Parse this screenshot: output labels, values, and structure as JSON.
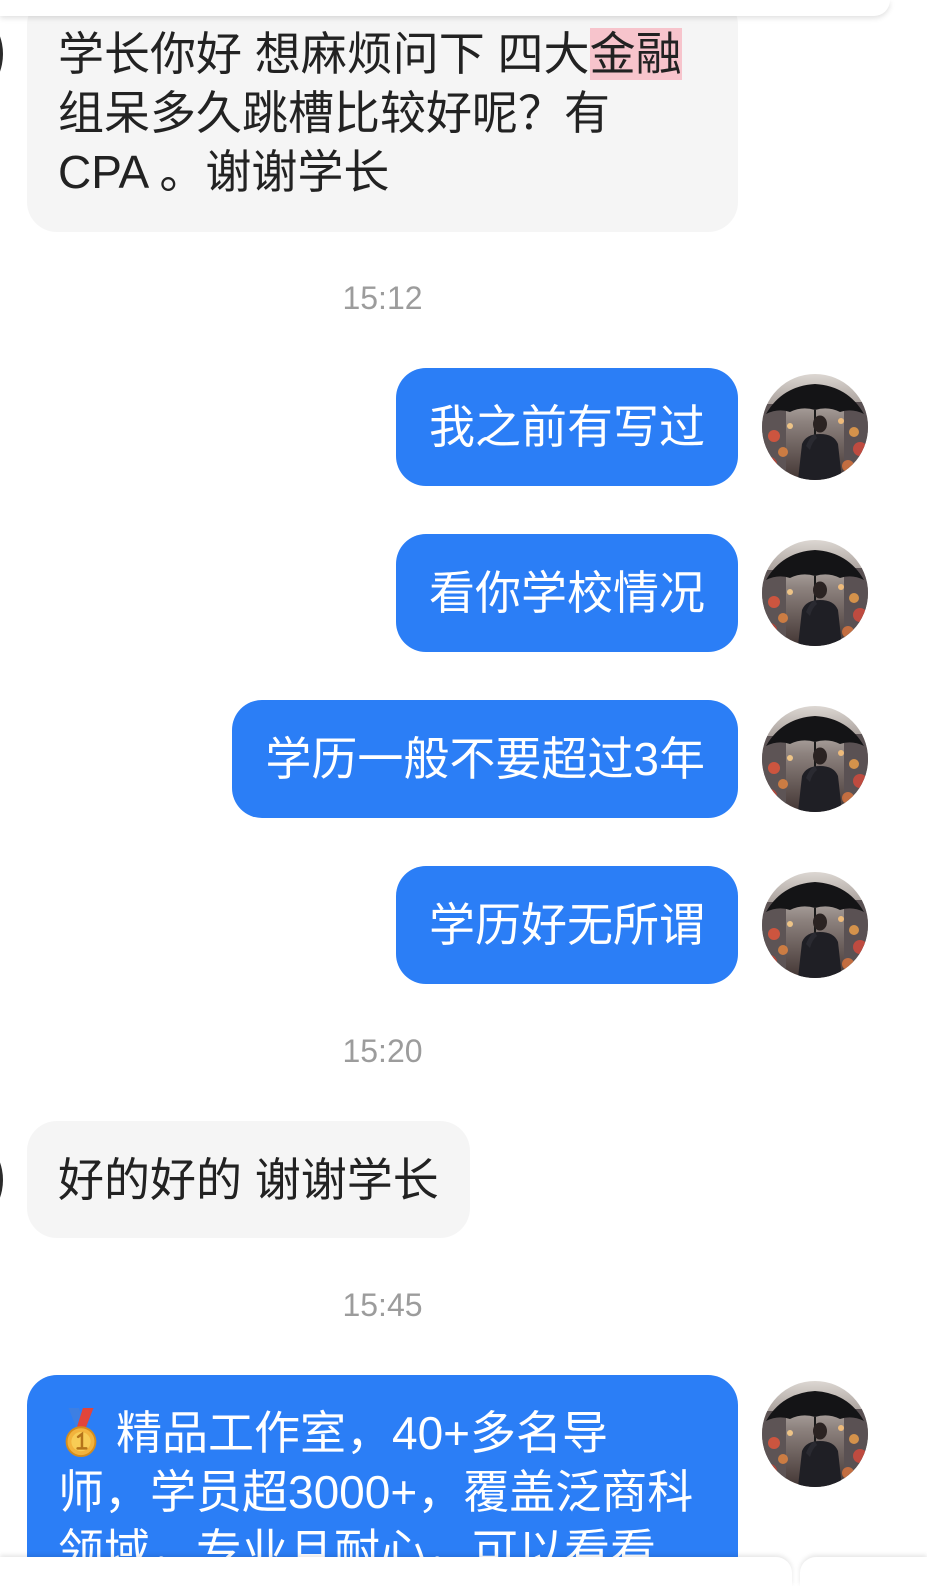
{
  "colors": {
    "background": "#ffffff",
    "incoming_bubble": "#f5f5f5",
    "incoming_text": "#222222",
    "outgoing_bubble": "#2b7ef6",
    "outgoing_text": "#ffffff",
    "highlight": "#f7c4cc",
    "timestamp_text": "#9c9c9c"
  },
  "icons": {
    "avatar": "man-with-umbrella-avatar-icon"
  },
  "conversation": [
    {
      "message": {
        "outgoing": false,
        "lines": [
          {
            "text": "学长你好 想麻烦问下 四大",
            "highlighted": "金融"
          },
          {
            "text": "组呆多久跳槽比较好呢？有"
          },
          {
            "text": "CPA 。谢谢学长"
          }
        ]
      }
    },
    {
      "timestamp": "15:12"
    },
    {
      "message": {
        "outgoing": true,
        "text": "我之前有写过"
      }
    },
    {
      "message": {
        "outgoing": true,
        "text": "看你学校情况"
      }
    },
    {
      "message": {
        "outgoing": true,
        "text": "学历一般不要超过3年"
      }
    },
    {
      "message": {
        "outgoing": true,
        "text": "学历好无所谓"
      }
    },
    {
      "timestamp": "15:20"
    },
    {
      "message": {
        "outgoing": false,
        "text": "好的好的 谢谢学长"
      }
    },
    {
      "timestamp": "15:45"
    },
    {
      "message": {
        "outgoing": true,
        "icon": "first-place-medal-icon",
        "lines": [
          {
            "text": "精品工作室，40+多名导"
          },
          {
            "text": "师，学员超3000+，覆盖泛商科"
          },
          {
            "text": "领域，专业且耐心，可以看看"
          }
        ]
      }
    }
  ]
}
